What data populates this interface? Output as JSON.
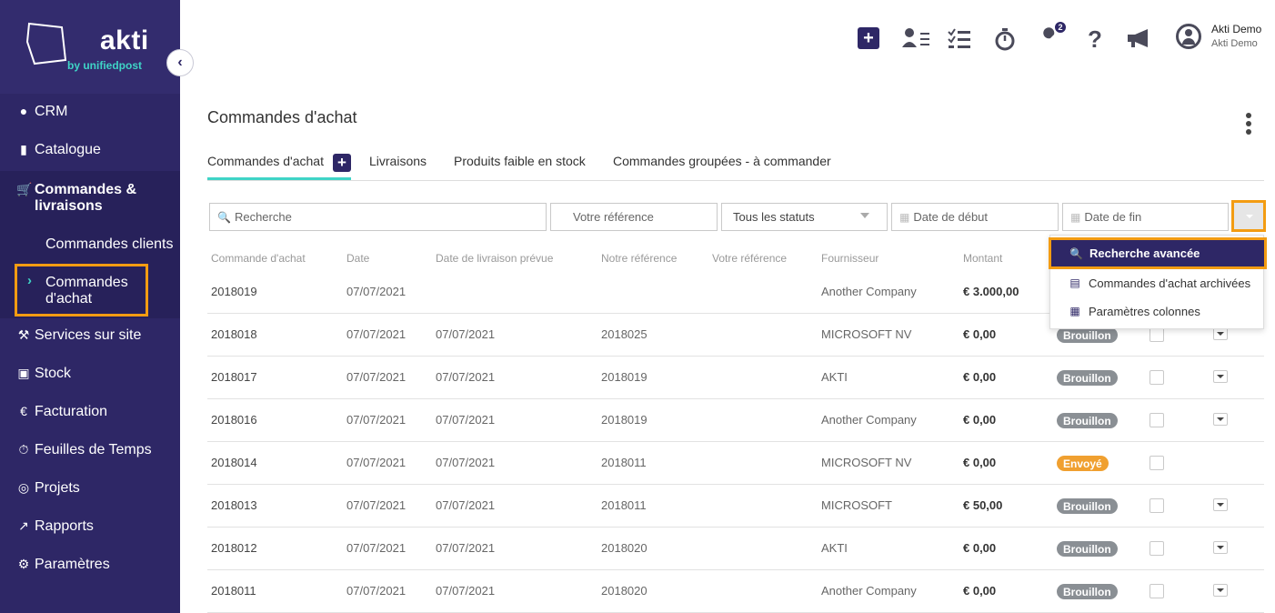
{
  "brand": {
    "name": "akti",
    "tagline": "by unifiedpost"
  },
  "sidebar": {
    "items": [
      {
        "label": "CRM",
        "icon": "user-icon"
      },
      {
        "label": "Catalogue",
        "icon": "book-icon"
      },
      {
        "label": "Commandes & livraisons",
        "icon": "cart-icon"
      },
      {
        "label": "Services sur site",
        "icon": "wrench-icon"
      },
      {
        "label": "Stock",
        "icon": "cubes-icon"
      },
      {
        "label": "Facturation",
        "icon": "euro-icon"
      },
      {
        "label": "Feuilles de Temps",
        "icon": "stopwatch-icon"
      },
      {
        "label": "Projets",
        "icon": "target-icon"
      },
      {
        "label": "Rapports",
        "icon": "chart-icon"
      },
      {
        "label": "Paramètres",
        "icon": "gear-icon"
      }
    ],
    "sub_items": [
      {
        "label": "Commandes clients"
      },
      {
        "label": "Commandes d'achat",
        "active": true
      }
    ]
  },
  "topbar": {
    "badge_count": "2",
    "user_name": "Akti Demo",
    "user_company": "Akti Demo"
  },
  "page": {
    "title": "Commandes d'achat"
  },
  "tabs": [
    {
      "label": "Commandes d'achat",
      "active": true
    },
    {
      "label": "Livraisons"
    },
    {
      "label": "Produits faible en stock"
    },
    {
      "label": "Commandes groupées - à commander"
    }
  ],
  "filters": {
    "search_placeholder": "Recherche",
    "reference_placeholder": "Votre référence",
    "status_value": "Tous les statuts",
    "start_date_placeholder": "Date de début",
    "end_date_placeholder": "Date de fin"
  },
  "table": {
    "headers": [
      "Commande d'achat",
      "Date",
      "Date de livraison prévue",
      "Notre référence",
      "Votre référence",
      "Fournisseur",
      "Montant"
    ],
    "rows": [
      {
        "id": "2018019",
        "date": "07/07/2021",
        "delivery": "",
        "our_ref": "",
        "your_ref": "",
        "supplier": "Another Company",
        "amount": "€ 3.000,00",
        "status": ""
      },
      {
        "id": "2018018",
        "date": "07/07/2021",
        "delivery": "07/07/2021",
        "our_ref": "2018025",
        "your_ref": "",
        "supplier": "MICROSOFT NV",
        "amount": "€ 0,00",
        "status": "Brouillon"
      },
      {
        "id": "2018017",
        "date": "07/07/2021",
        "delivery": "07/07/2021",
        "our_ref": "2018019",
        "your_ref": "",
        "supplier": "AKTI",
        "amount": "€ 0,00",
        "status": "Brouillon"
      },
      {
        "id": "2018016",
        "date": "07/07/2021",
        "delivery": "07/07/2021",
        "our_ref": "2018019",
        "your_ref": "",
        "supplier": "Another Company",
        "amount": "€ 0,00",
        "status": "Brouillon"
      },
      {
        "id": "2018014",
        "date": "07/07/2021",
        "delivery": "07/07/2021",
        "our_ref": "2018011",
        "your_ref": "",
        "supplier": "MICROSOFT NV",
        "amount": "€ 0,00",
        "status": "Envoyé"
      },
      {
        "id": "2018013",
        "date": "07/07/2021",
        "delivery": "07/07/2021",
        "our_ref": "2018011",
        "your_ref": "",
        "supplier": "MICROSOFT",
        "amount": "€ 50,00",
        "status": "Brouillon"
      },
      {
        "id": "2018012",
        "date": "07/07/2021",
        "delivery": "07/07/2021",
        "our_ref": "2018020",
        "your_ref": "",
        "supplier": "AKTI",
        "amount": "€ 0,00",
        "status": "Brouillon"
      },
      {
        "id": "2018011",
        "date": "07/07/2021",
        "delivery": "07/07/2021",
        "our_ref": "2018020",
        "your_ref": "",
        "supplier": "Another Company",
        "amount": "€ 0,00",
        "status": "Brouillon"
      }
    ]
  },
  "dropdown_menu": {
    "items": [
      {
        "label": "Recherche avancée",
        "icon": "search-icon"
      },
      {
        "label": "Commandes d'achat archivées",
        "icon": "archive-icon"
      },
      {
        "label": "Paramètres colonnes",
        "icon": "grid-icon"
      }
    ]
  },
  "colors": {
    "sidebar_bg": "#2e2766",
    "accent_teal": "#3fd4c6",
    "highlight_orange": "#f39c12",
    "status_draft": "#8a8f94",
    "status_sent": "#f0a030"
  }
}
